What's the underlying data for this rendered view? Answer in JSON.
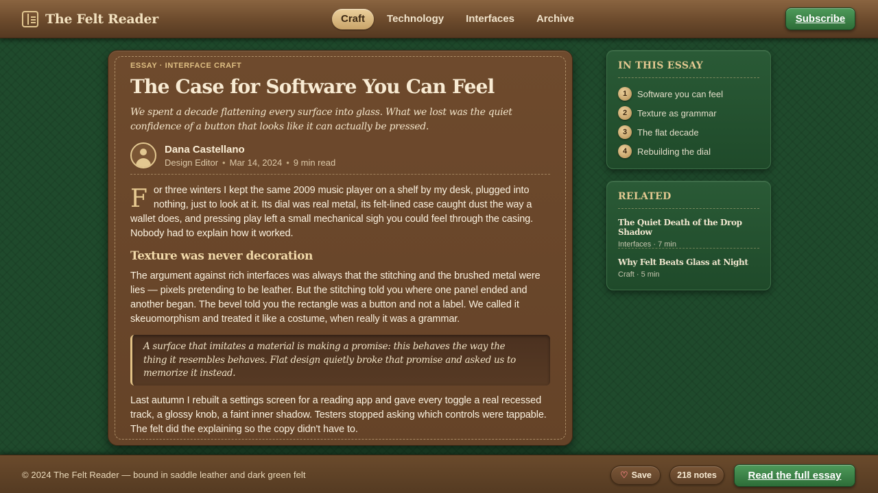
{
  "header": {
    "brand_name": "The Felt Reader",
    "brand_icon": "book-icon",
    "nav": [
      {
        "label": "Craft",
        "active": true
      },
      {
        "label": "Technology",
        "active": false
      },
      {
        "label": "Interfaces",
        "active": false
      },
      {
        "label": "Archive",
        "active": false
      }
    ],
    "subscribe_label": "Subscribe"
  },
  "article": {
    "kicker": "ESSAY · INTERFACE CRAFT",
    "title": "The Case for Software You Can Feel",
    "dek": "We spent a decade flattening every surface into glass. What we lost was the quiet confidence of a button that looks like it can actually be pressed.",
    "author": "Dana Castellano",
    "role": "Design Editor",
    "date": "Mar 14, 2024",
    "read_time": "9 min read",
    "meta_separator": "•",
    "drop_cap": "F",
    "paragraph1": "or three winters I kept the same 2009 music player on a shelf by my desk, plugged into nothing, just to look at it. Its dial was real metal, its felt-lined case caught dust the way a wallet does, and pressing play left a small mechanical sigh you could feel through the casing. Nobody had to explain how it worked.",
    "subheading": "Texture was never decoration",
    "paragraph2": "The argument against rich interfaces was always that the stitching and the brushed metal were lies — pixels pretending to be leather. But the stitching told you where one panel ended and another began. The bevel told you the rectangle was a button and not a label. We called it skeuomorphism and treated it like a costume, when really it was a grammar.",
    "pullquote": "A surface that imitates a material is making a promise: this behaves the way the thing it resembles behaves. Flat design quietly broke that promise and asked us to memorize it instead.",
    "paragraph3": "Last autumn I rebuilt a settings screen for a reading app and gave every toggle a real recessed track, a glossy knob, a faint inner shadow. Testers stopped asking which controls were tappable. The felt did the explaining so the copy didn't have to."
  },
  "toc": {
    "title": "IN THIS ESSAY",
    "items": [
      {
        "num": "1",
        "label": "Software you can feel"
      },
      {
        "num": "2",
        "label": "Texture as grammar"
      },
      {
        "num": "3",
        "label": "The flat decade"
      },
      {
        "num": "4",
        "label": "Rebuilding the dial"
      }
    ]
  },
  "related": {
    "title": "RELATED",
    "items": [
      {
        "title": "The Quiet Death of the Drop Shadow",
        "meta": "Interfaces · 7 min"
      },
      {
        "title": "Why Felt Beats Glass at Night",
        "meta": "Craft · 5 min"
      }
    ]
  },
  "footer": {
    "text": "© 2024 The Felt Reader — bound in saddle leather and dark green felt",
    "save_label": "Save",
    "save_icon": "heart-icon",
    "notes_label": "218 notes",
    "read_full_label": "Read the full essay"
  },
  "colors": {
    "felt_green": "#1f4a2c",
    "leather_brown": "#6b4a2c",
    "accent_gold": "#e3c891",
    "button_green": "#3f8a4b"
  }
}
